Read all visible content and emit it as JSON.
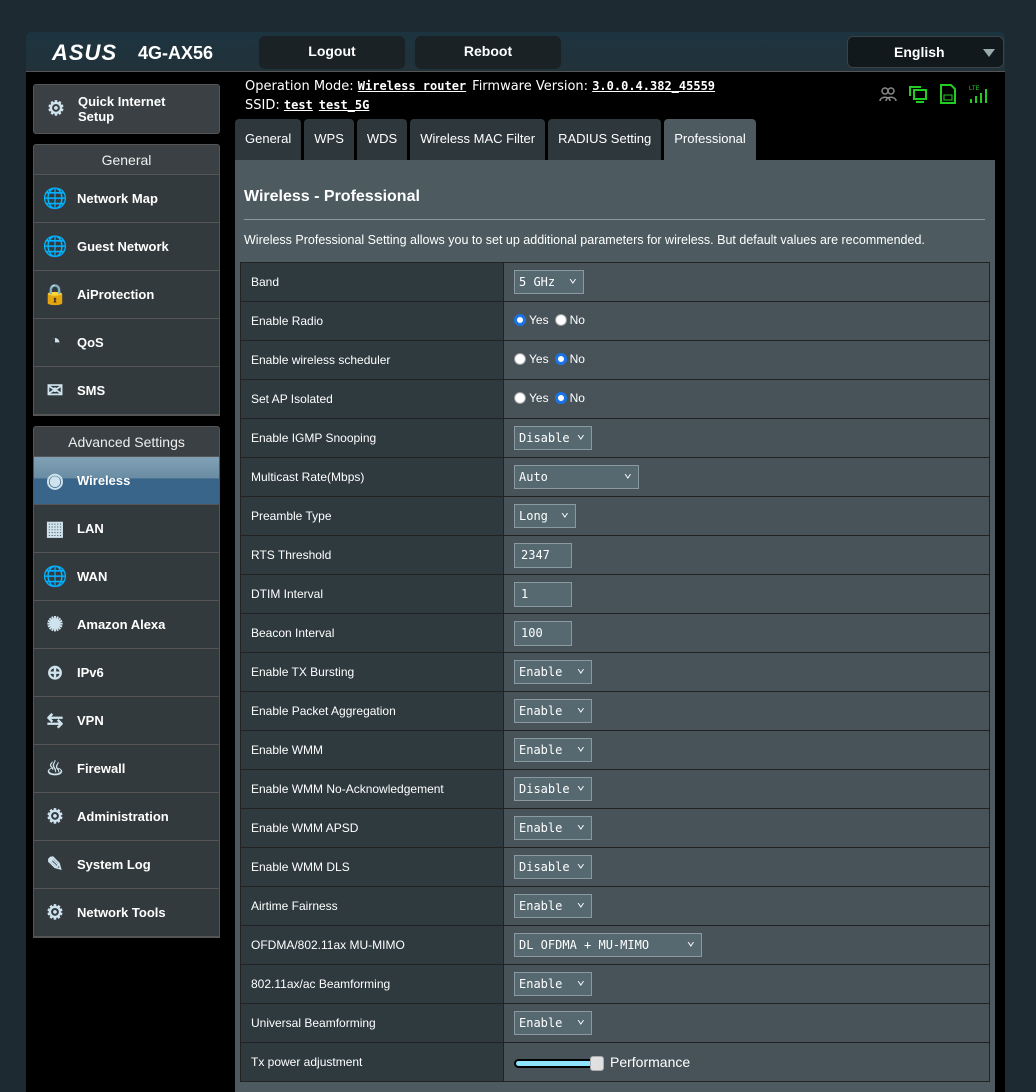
{
  "header": {
    "brand": "ASUS",
    "model": "4G-AX56",
    "logout": "Logout",
    "reboot": "Reboot",
    "language": "English"
  },
  "info": {
    "op_mode_label": "Operation Mode:",
    "op_mode": "Wireless router",
    "fw_label": "Firmware Version:",
    "fw": "3.0.0.4.382_45559",
    "ssid_label": "SSID:",
    "ssid1": "test",
    "ssid2": "test_5G"
  },
  "status_icons": [
    "clients-icon",
    "network-icon",
    "sim-icon",
    "lte-signal-icon"
  ],
  "sidebar": {
    "qis": "Quick Internet Setup",
    "general_title": "General",
    "general": [
      {
        "label": "Network Map",
        "icon": "globe-icon"
      },
      {
        "label": "Guest Network",
        "icon": "guest-icon"
      },
      {
        "label": "AiProtection",
        "icon": "lock-icon"
      },
      {
        "label": "QoS",
        "icon": "gauge-icon"
      },
      {
        "label": "SMS",
        "icon": "sms-icon"
      }
    ],
    "advanced_title": "Advanced Settings",
    "advanced": [
      {
        "label": "Wireless",
        "icon": "wifi-icon",
        "active": true
      },
      {
        "label": "LAN",
        "icon": "lan-icon"
      },
      {
        "label": "WAN",
        "icon": "globe-icon"
      },
      {
        "label": "Amazon Alexa",
        "icon": "alexa-icon"
      },
      {
        "label": "IPv6",
        "icon": "ipv6-icon"
      },
      {
        "label": "VPN",
        "icon": "vpn-icon"
      },
      {
        "label": "Firewall",
        "icon": "firewall-icon"
      },
      {
        "label": "Administration",
        "icon": "gear-icon"
      },
      {
        "label": "System Log",
        "icon": "log-icon"
      },
      {
        "label": "Network Tools",
        "icon": "tools-icon"
      }
    ]
  },
  "tabs": [
    "General",
    "WPS",
    "WDS",
    "Wireless MAC Filter",
    "RADIUS Setting",
    "Professional"
  ],
  "active_tab": "Professional",
  "page": {
    "title": "Wireless - Professional",
    "description": "Wireless Professional Setting allows you to set up additional parameters for wireless. But default values are recommended."
  },
  "settings": [
    {
      "label": "Band",
      "type": "select",
      "value": "5 GHz"
    },
    {
      "label": "Enable Radio",
      "type": "radio",
      "value": "Yes"
    },
    {
      "label": "Enable wireless scheduler",
      "type": "radio",
      "value": "No"
    },
    {
      "label": "Set AP Isolated",
      "type": "radio",
      "value": "No"
    },
    {
      "label": "Enable IGMP Snooping",
      "type": "select",
      "value": "Disable"
    },
    {
      "label": "Multicast Rate(Mbps)",
      "type": "select",
      "value": "Auto",
      "wide": 1
    },
    {
      "label": "Preamble Type",
      "type": "select",
      "value": "Long"
    },
    {
      "label": "RTS Threshold",
      "type": "input",
      "value": "2347"
    },
    {
      "label": "DTIM Interval",
      "type": "input",
      "value": "1"
    },
    {
      "label": "Beacon Interval",
      "type": "input",
      "value": "100"
    },
    {
      "label": "Enable TX Bursting",
      "type": "select",
      "value": "Enable"
    },
    {
      "label": "Enable Packet Aggregation",
      "type": "select",
      "value": "Enable"
    },
    {
      "label": "Enable WMM",
      "type": "select",
      "value": "Enable"
    },
    {
      "label": "Enable WMM No-Acknowledgement",
      "type": "select",
      "value": "Disable"
    },
    {
      "label": "Enable WMM APSD",
      "type": "select",
      "value": "Enable"
    },
    {
      "label": "Enable WMM DLS",
      "type": "select",
      "value": "Disable"
    },
    {
      "label": "Airtime Fairness",
      "type": "select",
      "value": "Enable"
    },
    {
      "label": "OFDMA/802.11ax MU-MIMO",
      "type": "select",
      "value": "DL OFDMA + MU-MIMO",
      "wide": 2
    },
    {
      "label": "802.11ax/ac Beamforming",
      "type": "select",
      "value": "Enable"
    },
    {
      "label": "Universal Beamforming",
      "type": "select",
      "value": "Enable"
    },
    {
      "label": "Tx power adjustment",
      "type": "slider",
      "value": "Performance",
      "level": 1.0
    }
  ],
  "radio_options": [
    "Yes",
    "No"
  ]
}
